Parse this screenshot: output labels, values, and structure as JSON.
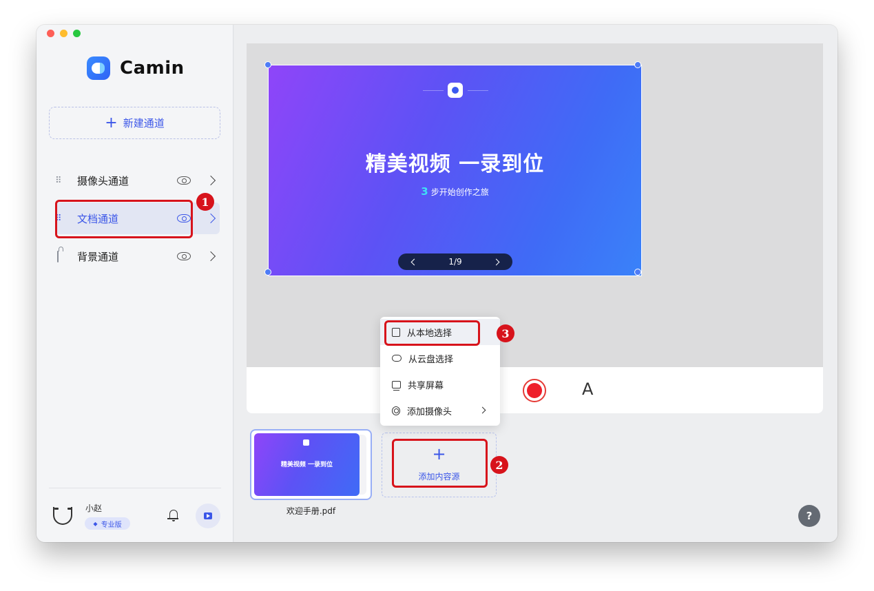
{
  "app": {
    "name": "Camin"
  },
  "sidebar": {
    "new_channel_label": "新建通道",
    "channels": [
      {
        "label": "摄像头通道"
      },
      {
        "label": "文档通道"
      },
      {
        "label": "背景通道"
      }
    ],
    "user": {
      "name": "小赵",
      "badge": "专业版"
    }
  },
  "slide": {
    "title": "精美视频  一录到位",
    "subtitle_num": "3",
    "subtitle": "步开始创作之旅",
    "page_indicator": "1/9"
  },
  "dropdown": {
    "items": [
      {
        "label": "从本地选择"
      },
      {
        "label": "从云盘选择"
      },
      {
        "label": "共享屏幕"
      },
      {
        "label": "添加摄像头"
      }
    ]
  },
  "sources": {
    "thumb_title": "精美视频  一录到位",
    "file_label": "欢迎手册.pdf",
    "add_label": "添加内容源"
  },
  "toolbar": {
    "pen_glyph": "A"
  },
  "help": {
    "glyph": "?"
  },
  "annotations": [
    "1",
    "2",
    "3"
  ],
  "colors": {
    "accent": "#3b56e8",
    "record": "#ee1f2b",
    "annotation": "#d7131b"
  }
}
